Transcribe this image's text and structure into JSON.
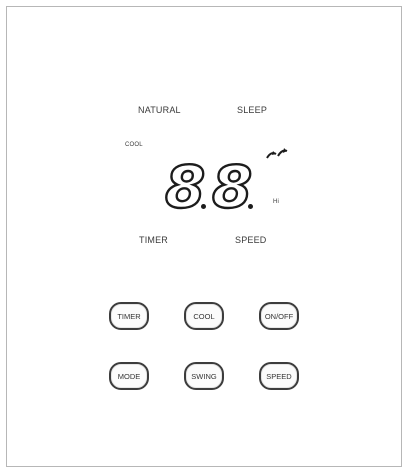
{
  "display": {
    "natural_label": "NATURAL",
    "sleep_label": "SLEEP",
    "cool_indicator": "COOL",
    "digit_1": "8",
    "digit_2": "8",
    "speed_indicator": "Hi",
    "timer_label": "TIMER",
    "speed_label": "SPEED",
    "swing_icon": "swing-arrows-icon"
  },
  "buttons": {
    "row1": [
      "TIMER",
      "COOL",
      "ON/OFF"
    ],
    "row2": [
      "MODE",
      "SWING",
      "SPEED"
    ]
  },
  "colors": {
    "segment": "#1c1c1c",
    "button_border": "#3c3c3c",
    "panel_border": "#b7b7b7"
  }
}
